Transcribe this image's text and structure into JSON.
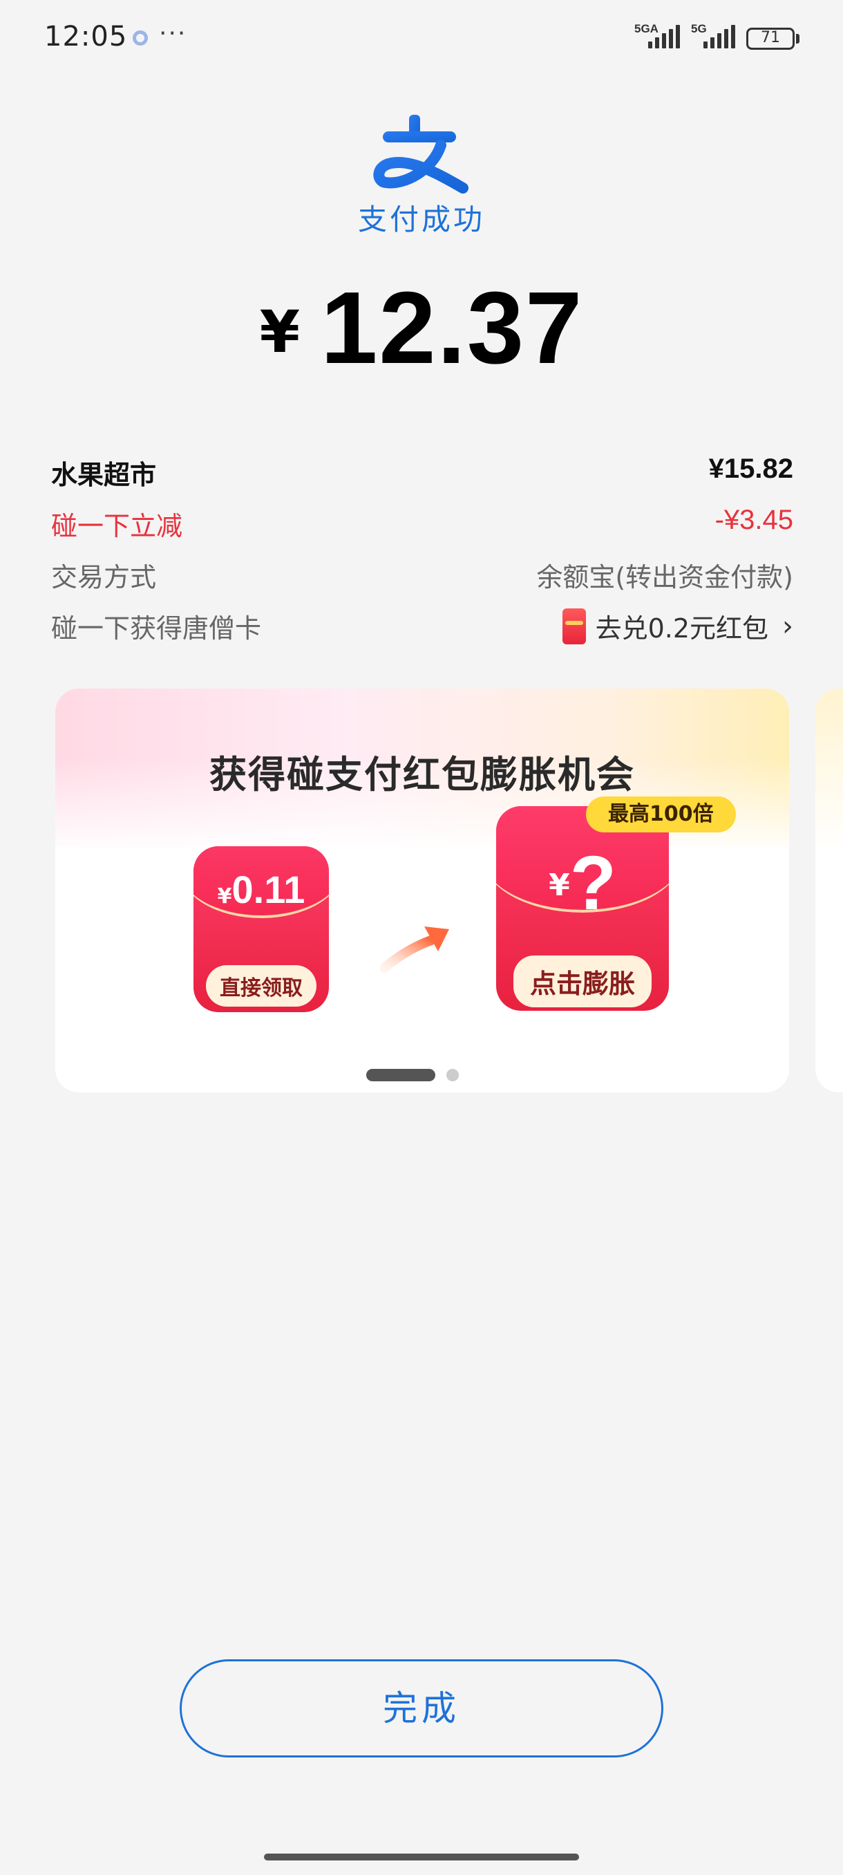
{
  "status_bar": {
    "time": "12:05",
    "more": "···",
    "signal1_label": "5GA",
    "signal2_label": "5G",
    "battery": "71"
  },
  "header": {
    "logo_icon": "alipay-zhi-icon",
    "success_text": "支付成功",
    "currency": "¥",
    "amount": "12.37"
  },
  "details": {
    "merchant_label": "水果超市",
    "merchant_value": "¥15.82",
    "discount_label": "碰一下立减",
    "discount_value": "-¥3.45",
    "method_label": "交易方式",
    "method_value": "余额宝(转出资金付款)",
    "card_label": "碰一下获得唐僧卡",
    "card_value": "去兑0.2元红包"
  },
  "promo": {
    "title": "获得碰支付红包膨胀机会",
    "small_env": {
      "currency": "¥",
      "value": "0.11",
      "button": "直接领取"
    },
    "big_env": {
      "currency": "¥",
      "value": "?",
      "button": "点击膨胀"
    },
    "badge": "最高100倍"
  },
  "footer": {
    "done_label": "完成"
  },
  "colors": {
    "accent_blue": "#1e72d8",
    "discount_red": "#e8323c",
    "envelope_red": "#e8213f",
    "badge_yellow": "#ffd83a"
  }
}
